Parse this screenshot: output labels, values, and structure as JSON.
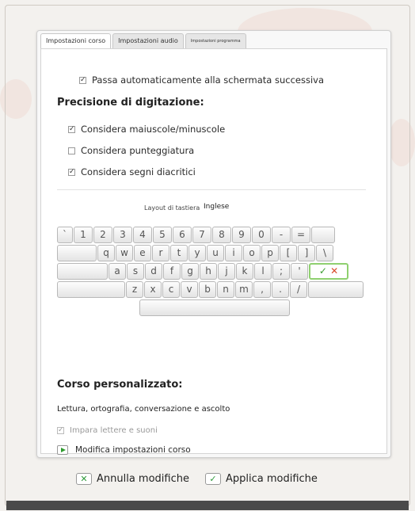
{
  "colors": {
    "accent_green": "#3a9c2e",
    "cancel_red": "#d94a2a",
    "dialog_bg": "#f8f8f8"
  },
  "tabs": [
    {
      "label": "Impostazioni corso",
      "active": true
    },
    {
      "label": "Impostazioni audio",
      "active": false
    },
    {
      "label": "Impostazioni programma",
      "active": false
    }
  ],
  "auto_advance": {
    "label": "Passa automaticamente alla schermata successiva",
    "checked": true
  },
  "precision": {
    "heading": "Precisione di digitazione:",
    "options": [
      {
        "label": "Considera maiuscole/minuscole",
        "checked": true
      },
      {
        "label": "Considera punteggiatura",
        "checked": false
      },
      {
        "label": "Considera segni diacritici",
        "checked": true
      }
    ]
  },
  "keyboard": {
    "layout_label": "Layout di tastiera",
    "layout_value": "Inglese",
    "rows": [
      [
        "`",
        "1",
        "2",
        "3",
        "4",
        "5",
        "6",
        "7",
        "8",
        "9",
        "0",
        "-",
        "="
      ],
      [
        "q",
        "w",
        "e",
        "r",
        "t",
        "y",
        "u",
        "i",
        "o",
        "p",
        "[",
        "]",
        "\\"
      ],
      [
        "a",
        "s",
        "d",
        "f",
        "g",
        "h",
        "j",
        "k",
        "l",
        ";",
        "'"
      ],
      [
        "z",
        "x",
        "c",
        "v",
        "b",
        "n",
        "m",
        ",",
        ".",
        "/"
      ]
    ],
    "ok_key": {
      "tick": "✓",
      "cross": "✕"
    }
  },
  "custom_course": {
    "heading": "Corso personalizzato:",
    "description": "Lettura, ortografia, conversazione e ascolto",
    "learn_letters": {
      "label": "Impara lettere e suoni",
      "checked": true,
      "disabled": true
    },
    "edit_label": "Modifica impostazioni corso"
  },
  "buttons": {
    "cancel_label": "Annulla modifiche",
    "apply_label": "Applica modifiche",
    "cancel_icon": "✕",
    "apply_icon": "✓"
  }
}
